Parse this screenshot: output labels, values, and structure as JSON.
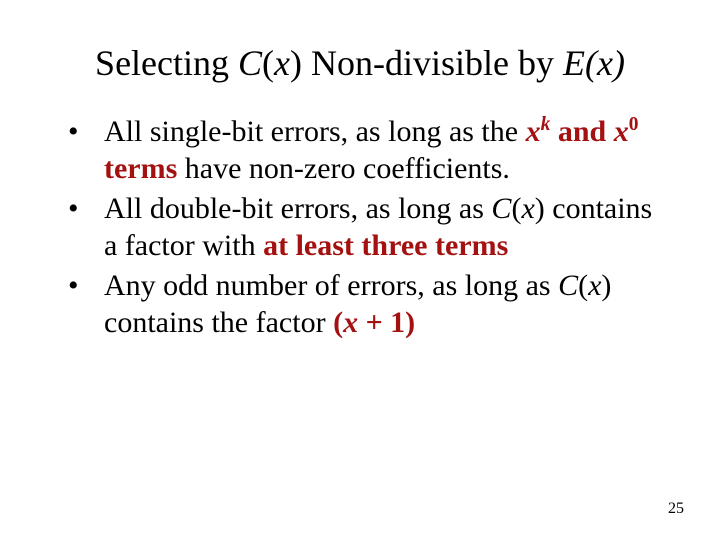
{
  "title": {
    "t1": "Selecting ",
    "t2": "C",
    "t3": "(",
    "t4": "x",
    "t5": ") Non-divisible by ",
    "t6": "E(x)"
  },
  "bullets": {
    "b1": {
      "s1": "All single-bit errors, as long as the ",
      "s2": "x",
      "s3": "k",
      "s4": " and ",
      "s5": "x",
      "s6": "0",
      "s7": " terms",
      "s8": " have non-zero coefficients."
    },
    "b2": {
      "s1": "All double-bit errors, as long as ",
      "s2": "C",
      "s3": "(",
      "s4": "x",
      "s5": ") contains a factor with ",
      "s6": "at least three terms"
    },
    "b3": {
      "s1": "Any odd number of errors, as long as ",
      "s2": "C",
      "s3": "(",
      "s4": "x",
      "s5": ") contains the factor ",
      "s6": "(",
      "s7": "x",
      "s8": " + 1)"
    }
  },
  "page_number": "25"
}
